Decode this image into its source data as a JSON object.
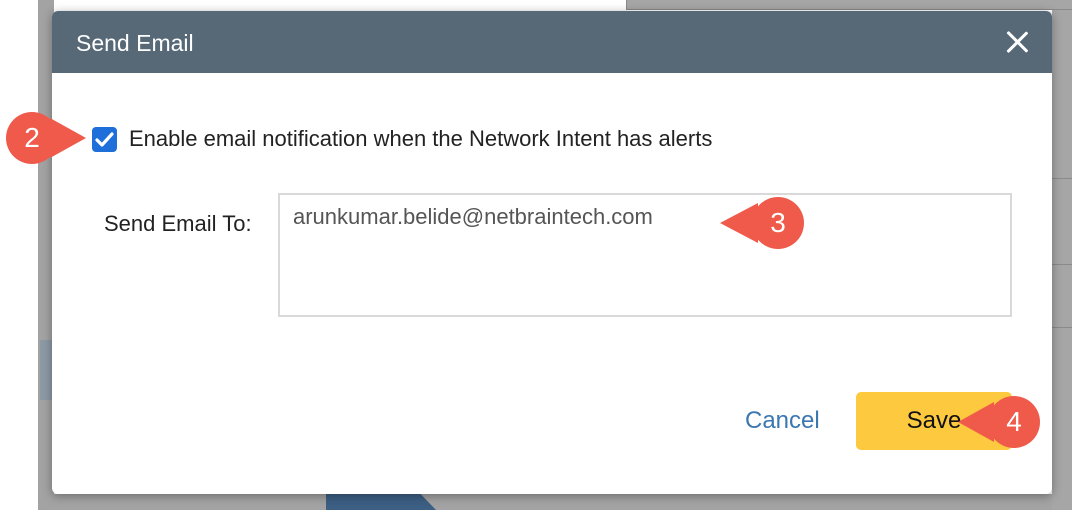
{
  "dialog": {
    "title": "Send Email",
    "close_icon": "close-icon"
  },
  "notification": {
    "checkbox_checked": true,
    "checkbox_label": "Enable email notification when the Network Intent has alerts"
  },
  "email": {
    "label": "Send Email To:",
    "value": "arunkumar.belide@netbraintech.com"
  },
  "actions": {
    "cancel_label": "Cancel",
    "save_label": "Save"
  },
  "callouts": [
    "2",
    "3",
    "4"
  ],
  "colors": {
    "header": "#576877",
    "checkbox": "#1e6fd9",
    "save_button": "#fdc93e",
    "cancel_link": "#3b77b0",
    "callout": "#ef5a4a"
  }
}
